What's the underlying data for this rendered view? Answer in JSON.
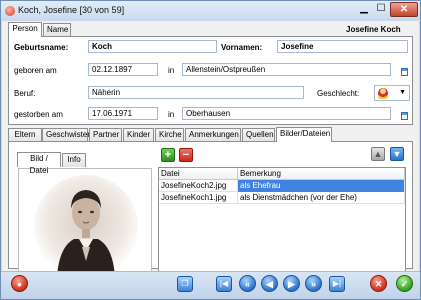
{
  "window": {
    "title": "Koch, Josefine [30 von 59]"
  },
  "top_tabs": [
    "Person",
    "Name"
  ],
  "person_name_display": "Josefine Koch",
  "fields": {
    "geburtsname_label": "Geburtsname:",
    "geburtsname_value": "Koch",
    "vornamen_label": "Vornamen:",
    "vornamen_value": "Josefine",
    "geboren_label": "geboren am",
    "geboren_date": "02.12.1897",
    "geboren_in_label": "in",
    "geboren_place": "Allenstein/Ostpreußen",
    "beruf_label": "Beruf:",
    "beruf_value": "Näherin",
    "geschlecht_label": "Geschlecht:",
    "gestorben_label": "gestorben am",
    "gestorben_date": "17.06.1971",
    "gestorben_in_label": "in",
    "gestorben_place": "Oberhausen"
  },
  "section_tabs": [
    "Eltern",
    "Geschwister",
    "Partner",
    "Kinder",
    "Kirche",
    "Anmerkungen",
    "Quellen",
    "Bilder/Dateien"
  ],
  "active_section_tab": "Bilder/Dateien",
  "media_tabs": [
    "Bild / Datei",
    "Info"
  ],
  "grid": {
    "columns": [
      "Datei",
      "Bemerkung"
    ],
    "rows": [
      {
        "file": "JosefineKoch2.jpg",
        "remark": "als Ehefrau",
        "selected": true
      },
      {
        "file": "JosefineKoch1.jpg",
        "remark": "als Dienstmädchen (vor der Ehe)",
        "selected": false
      }
    ]
  },
  "icons": {
    "add": "plus-icon",
    "remove": "minus-icon",
    "move_up": "arrow-up-icon",
    "move_down": "arrow-down-icon",
    "gender": "female-icon",
    "calendar": "calendar-icon"
  },
  "colors": {
    "accent": "#3f82e0",
    "add_green": "#34a11f",
    "remove_red": "#c9271a"
  }
}
